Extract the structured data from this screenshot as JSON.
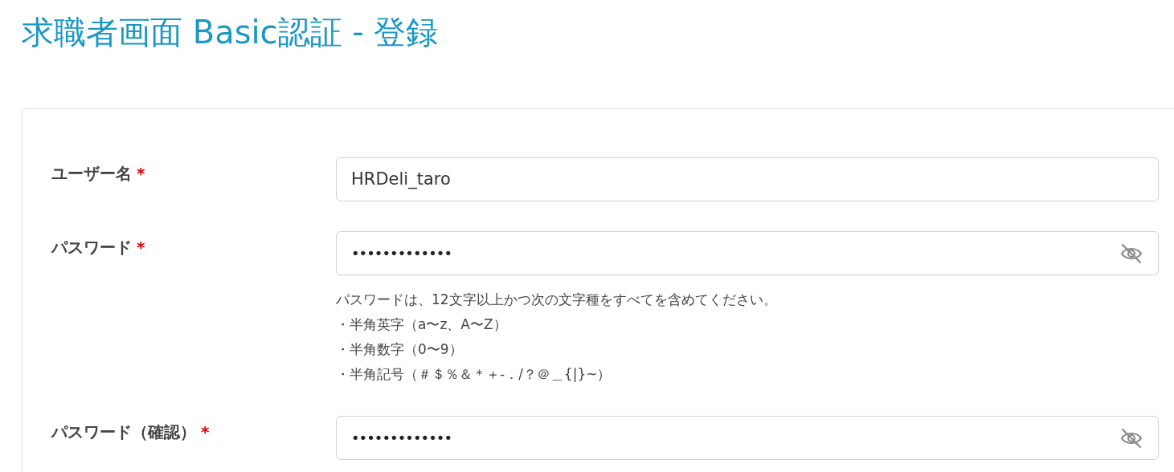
{
  "title": "求職者画面 Basic認証 - 登録",
  "fields": [
    {
      "kind": "text",
      "label": "ユーザー名",
      "required_mark": "*",
      "value": "HRDeli_taro"
    },
    {
      "kind": "password",
      "label": "パスワード",
      "required_mark": "*",
      "value": "•••••••••••••",
      "hint": [
        "パスワードは、12文字以上かつ次の文字種をすべてを含めてください。",
        "・半角英字（a〜z、A〜Z）",
        "・半角数字（0〜9）",
        "・半角記号（＃＄％＆＊＋-．/？＠＿{|}~）"
      ]
    },
    {
      "kind": "password",
      "label": "パスワード（確認）",
      "required_mark": "*",
      "value": "•••••••••••••"
    }
  ]
}
